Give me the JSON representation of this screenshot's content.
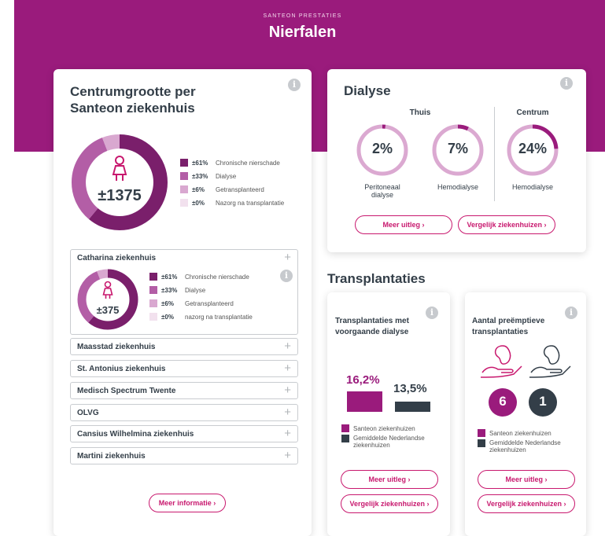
{
  "header": {
    "supertitle": "SANTEON PRESTATIES",
    "title": "Nierfalen"
  },
  "colors": {
    "brand": "#9a1b7c",
    "dark": "#333e48",
    "accent": "#c8186e"
  },
  "centrum": {
    "title_line1": "Centrumgrootte per",
    "title_line2": "Santeon ziekenhuis",
    "total": "±1375",
    "legend": [
      {
        "pct": "±61%",
        "label": "Chronische nierschade",
        "color": "#7a1f6b"
      },
      {
        "pct": "±33%",
        "label": "Dialyse",
        "color": "#b35ea6"
      },
      {
        "pct": "±6%",
        "label": "Getransplanteerd",
        "color": "#d9a8d0"
      },
      {
        "pct": "±0%",
        "label": "Nazorg na transplantatie",
        "color": "#f2e1ee"
      }
    ],
    "hospitals": [
      {
        "name": "Catharina ziekenhuis",
        "total": "±375",
        "legend": [
          {
            "pct": "±61%",
            "label": "Chronische nierschade"
          },
          {
            "pct": "±33%",
            "label": "Dialyse"
          },
          {
            "pct": "±6%",
            "label": "Getransplanteerd"
          },
          {
            "pct": "±0%",
            "label": "nazorg na transplantatie"
          }
        ]
      },
      {
        "name": "Maasstad ziekenhuis"
      },
      {
        "name": "St. Antonius ziekenhuis"
      },
      {
        "name": "Medisch Spectrum Twente"
      },
      {
        "name": "OLVG"
      },
      {
        "name": "Cansius Wilhelmina ziekenhuis"
      },
      {
        "name": "Martini ziekenhuis"
      }
    ],
    "more_button": "Meer informatie ›",
    "plus": "+"
  },
  "dialyse": {
    "title": "Dialyse",
    "thuis": "Thuis",
    "centrum": "Centrum",
    "rings": [
      {
        "value": "2%",
        "fraction": 0.02,
        "label_line1": "Peritoneaal",
        "label_line2": "dialyse"
      },
      {
        "value": "7%",
        "fraction": 0.07,
        "label_line1": "Hemodialyse",
        "label_line2": ""
      },
      {
        "value": "24%",
        "fraction": 0.24,
        "label_line1": "Hemodialyse",
        "label_line2": ""
      }
    ],
    "btn_more": "Meer uitleg ›",
    "btn_compare": "Vergelijk ziekenhuizen ›"
  },
  "transplantaties": {
    "title": "Transplantaties",
    "card1": {
      "title_line1": "Transplantaties met",
      "title_line2": "voorgaande dialyse",
      "santeon_value": "16,2%",
      "national_value": "13,5%",
      "legend_santeon": "Santeon ziekenhuizen",
      "legend_national_line1": "Gemiddelde Nederlandse",
      "legend_national_line2": "ziekenhuizen",
      "btn_more": "Meer uitleg ›",
      "btn_compare": "Vergelijk ziekenhuizen ›"
    },
    "card2": {
      "title_line1": "Aantal preëmptieve",
      "title_line2": "transplantaties",
      "santeon_value": "6",
      "national_value": "1",
      "legend_santeon": "Santeon ziekenhuizen",
      "legend_national_line1": "Gemiddelde Nederlandse",
      "legend_national_line2": "ziekenhuizen",
      "btn_more": "Meer uitleg ›",
      "btn_compare": "Vergelijk ziekenhuizen ›"
    }
  },
  "info_glyph": "i"
}
